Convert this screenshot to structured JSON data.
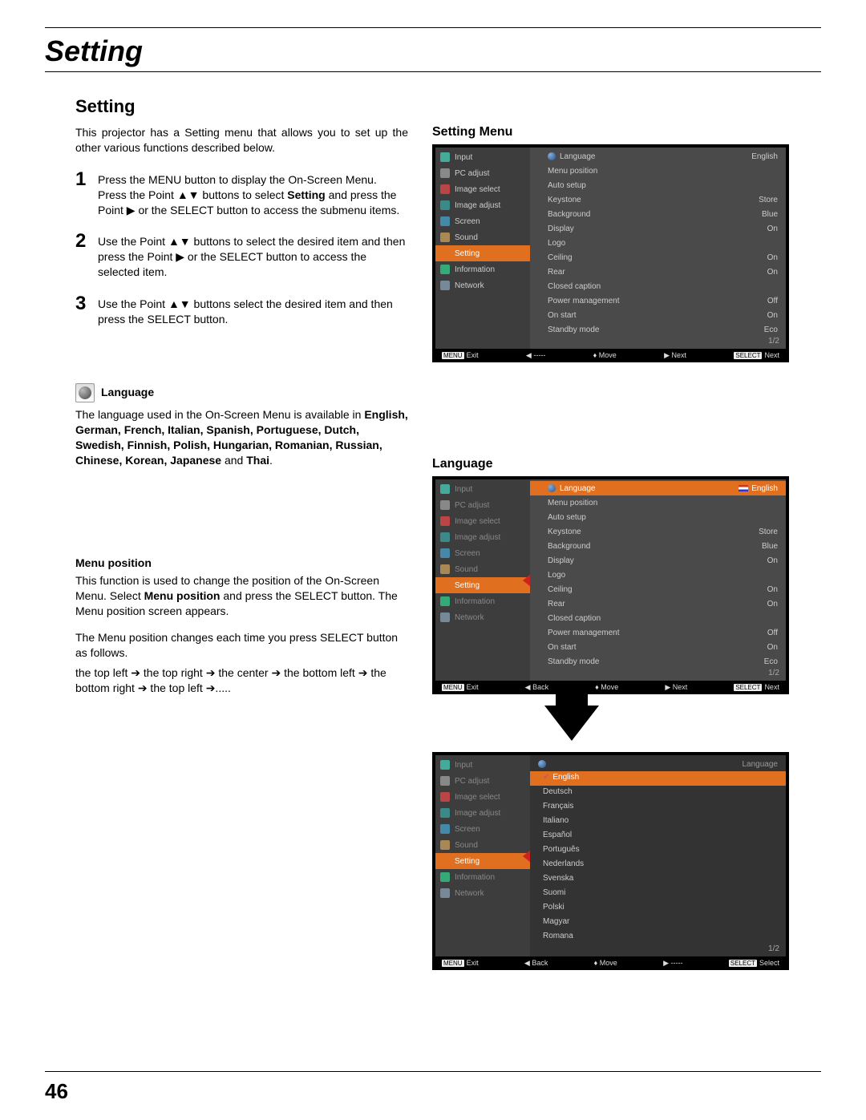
{
  "chapter": "Setting",
  "section": "Setting",
  "pageNumber": "46",
  "intro": "This projector has a Setting menu that allows you to set up the other various functions described below.",
  "steps": [
    {
      "n": "1",
      "pre": "Press the MENU button to display the On-Screen Menu. Press the Point ▲▼ buttons to select ",
      "bold": "Setting",
      "post": " and press the Point ▶ or the SELECT button to access the submenu items."
    },
    {
      "n": "2",
      "pre": "Use the Point ▲▼ buttons to select the desired item and then press the Point ▶ or the SELECT button to access the selected item.",
      "bold": "",
      "post": ""
    },
    {
      "n": "3",
      "pre": "Use the Point ▲▼ buttons select the desired item and then press the SELECT button.",
      "bold": "",
      "post": ""
    }
  ],
  "language": {
    "heading": "Language",
    "line1": "The language used in the On-Screen Menu is available in ",
    "boldList": "English, German, French, Italian, Spanish, Portuguese, Dutch, Swedish, Finnish, Polish, Hungarian, Romanian, Russian, Chinese, Korean, Japanese",
    "andWord": " and ",
    "lastLang": "Thai",
    "period": "."
  },
  "menuPosition": {
    "heading": "Menu position",
    "p1a": "This function is used to change the position of the On-Screen Menu. Select ",
    "p1bold": "Menu position",
    "p1b": " and press the SELECT button. The Menu position screen appears.",
    "p2": "The Menu position changes each time you press SELECT button as follows.",
    "p3": "the top left  ➔ the top right  ➔ the center ➔ the bottom left ➔ the bottom right  ➔ the top left ➔....."
  },
  "right": {
    "settingMenuTitle": "Setting Menu",
    "languageTitle": "Language"
  },
  "osd": {
    "sideItems": [
      "Input",
      "PC adjust",
      "Image select",
      "Image adjust",
      "Screen",
      "Sound",
      "Setting",
      "Information",
      "Network"
    ],
    "mainRows1": [
      {
        "label": "Language",
        "val": "English",
        "globe": true
      },
      {
        "label": "Menu position",
        "val": ""
      },
      {
        "label": "Auto setup",
        "val": ""
      },
      {
        "label": "Keystone",
        "val": "Store"
      },
      {
        "label": "Background",
        "val": "Blue"
      },
      {
        "label": "Display",
        "val": "On"
      },
      {
        "label": "Logo",
        "val": ""
      },
      {
        "label": "Ceiling",
        "val": "On"
      },
      {
        "label": "Rear",
        "val": "On"
      },
      {
        "label": "Closed caption",
        "val": ""
      },
      {
        "label": "Power management",
        "val": "Off"
      },
      {
        "label": "On start",
        "val": "On"
      },
      {
        "label": "Standby mode",
        "val": "Eco"
      }
    ],
    "pageIndicator": "1/2",
    "footer1": {
      "exit": "Exit",
      "back": "-----",
      "move": "Move",
      "next": "Next",
      "select": "Next"
    },
    "footer2": {
      "exit": "Exit",
      "back": "Back",
      "move": "Move",
      "next": "Next",
      "select": "Next"
    },
    "footer3": {
      "exit": "Exit",
      "back": "Back",
      "move": "Move",
      "next": "-----",
      "select": "Select"
    },
    "languageList": [
      "English",
      "Deutsch",
      "Français",
      "Italiano",
      "Español",
      "Português",
      "Nederlands",
      "Svenska",
      "Suomi",
      "Polski",
      "Magyar",
      "Romana"
    ],
    "langTop": "Language",
    "menuBadge": "MENU",
    "selectBadge": "SELECT"
  }
}
